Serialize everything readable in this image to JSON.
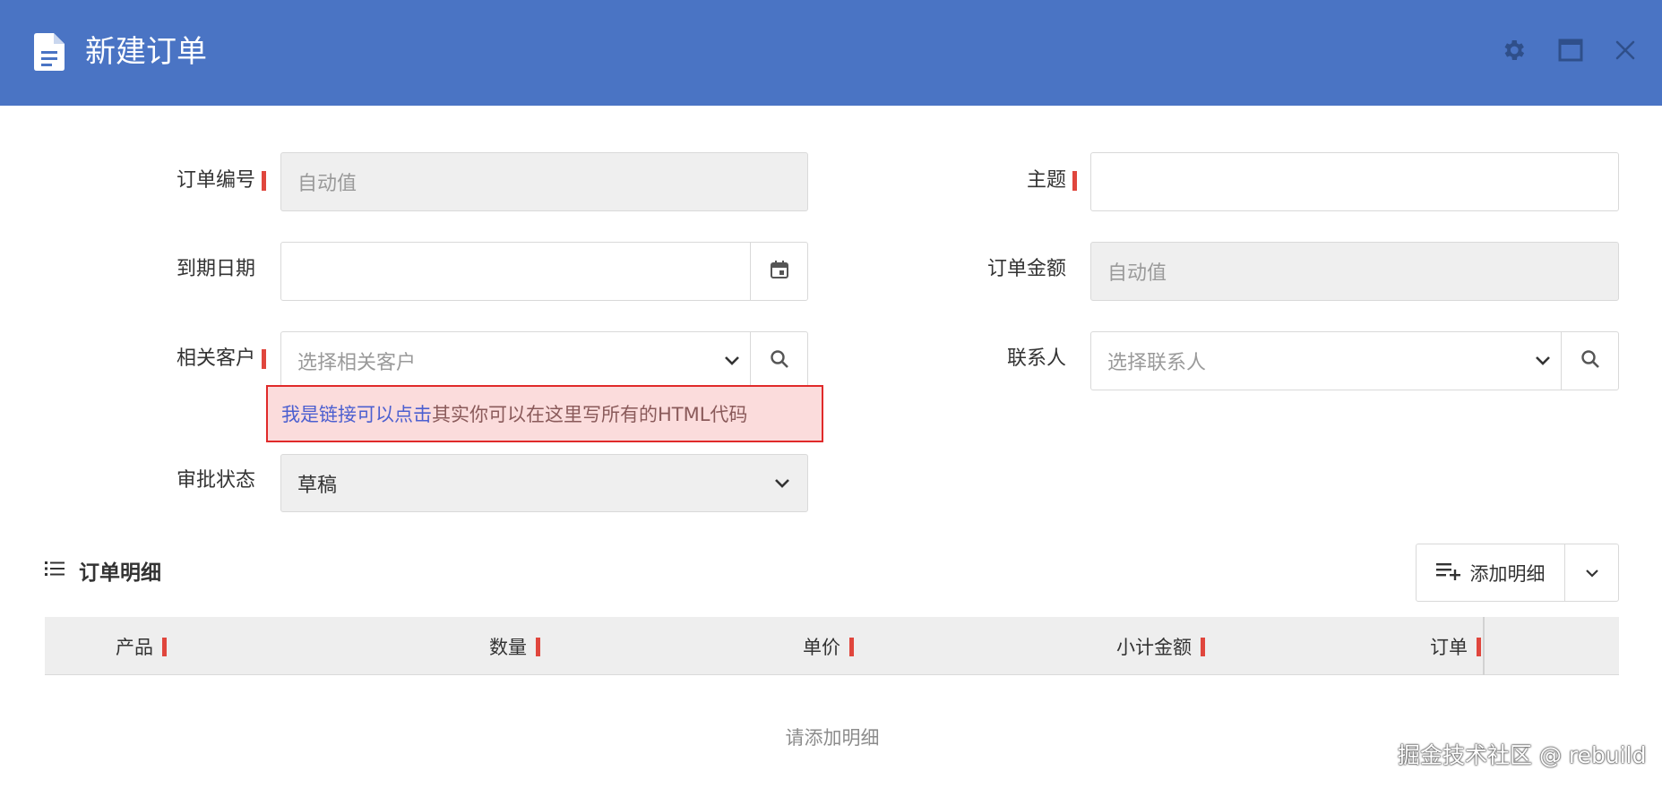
{
  "window": {
    "title": "新建订单",
    "accent": "#4a74c4",
    "icons": [
      "document-icon",
      "gear-icon",
      "maximize-icon",
      "close-icon"
    ]
  },
  "form": {
    "order_no": {
      "label": "订单编号",
      "placeholder": "自动值",
      "required": true
    },
    "subject": {
      "label": "主题",
      "value": "",
      "required": true
    },
    "due_date": {
      "label": "到期日期",
      "value": ""
    },
    "amount": {
      "label": "订单金额",
      "placeholder": "自动值"
    },
    "customer": {
      "label": "相关客户",
      "placeholder": "选择相关客户",
      "required": true
    },
    "contact": {
      "label": "联系人",
      "placeholder": "选择联系人"
    },
    "hint": {
      "link": "我是链接可以点击",
      "rest": "其实你可以在这里写所有的HTML代码"
    },
    "status": {
      "label": "审批状态",
      "value": "草稿"
    }
  },
  "details": {
    "title": "订单明细",
    "add_label": "添加明细",
    "columns": [
      {
        "label": "产品",
        "required": true
      },
      {
        "label": "数量",
        "required": true
      },
      {
        "label": "单价",
        "required": true
      },
      {
        "label": "小计金额",
        "required": true
      },
      {
        "label": "订单",
        "required": true
      }
    ],
    "empty_text": "请添加明细"
  },
  "watermark": "掘金技术社区 @ rebuild",
  "colors": {
    "required": "#e0463d",
    "hint_border": "#e02a2a",
    "hint_bg": "#fbdcdc",
    "link": "#4c5fd0"
  }
}
